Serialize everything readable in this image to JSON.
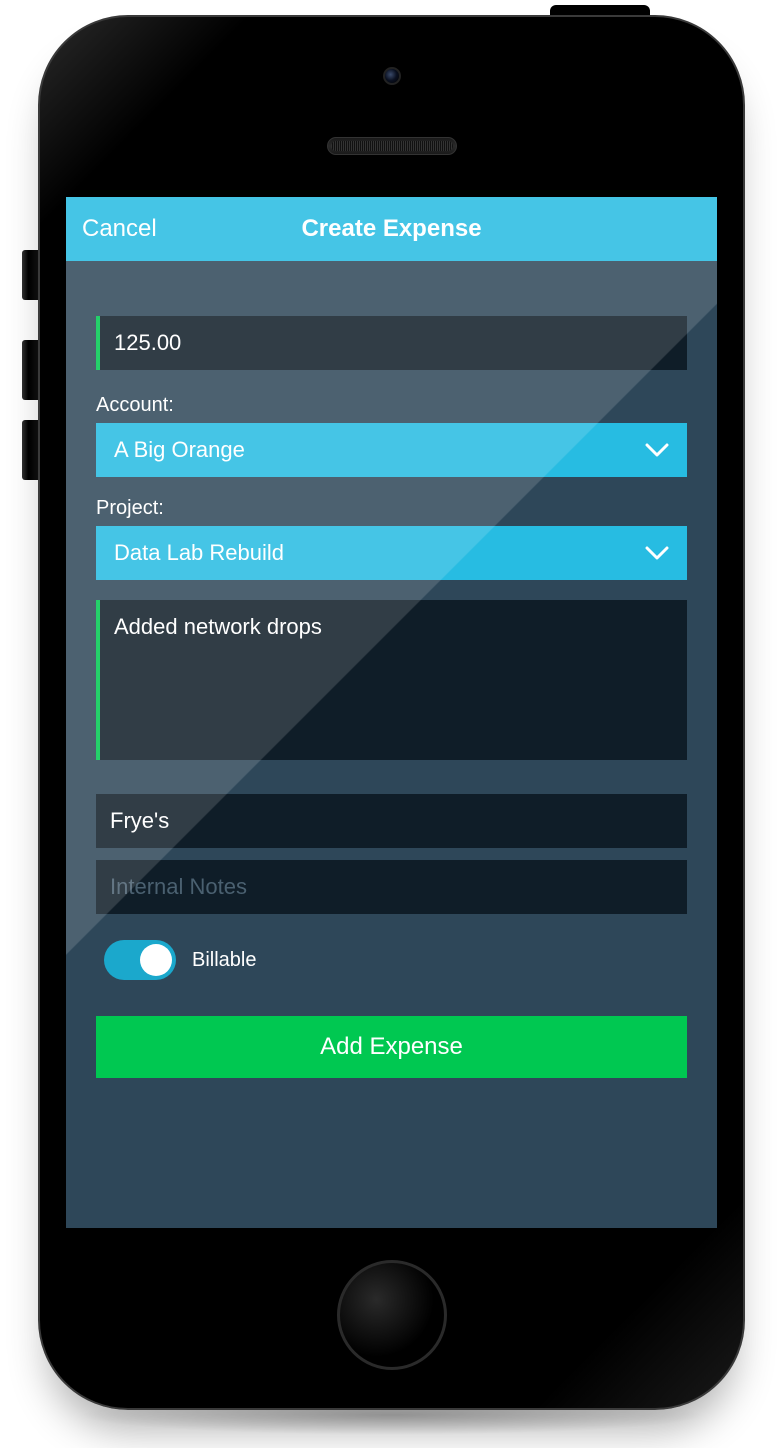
{
  "header": {
    "cancel_label": "Cancel",
    "title": "Create Expense"
  },
  "form": {
    "amount_value": "125.00",
    "account_label": "Account:",
    "account_value": "A Big Orange",
    "project_label": "Project:",
    "project_value": "Data Lab Rebuild",
    "description_value": "Added network drops",
    "vendor_value": "Frye's",
    "internal_notes_placeholder": "Internal Notes",
    "billable_label": "Billable",
    "billable_on": true,
    "submit_label": "Add Expense"
  },
  "colors": {
    "accent_cyan": "#27bce2",
    "accent_green": "#00c851",
    "bg_dark": "#2e4759",
    "input_dark": "#0f1d28"
  }
}
